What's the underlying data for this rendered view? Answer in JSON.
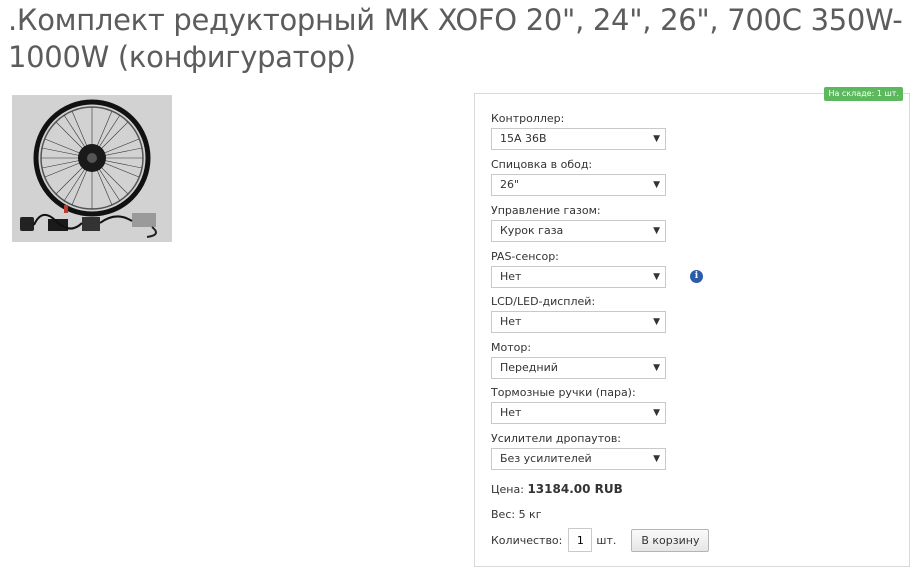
{
  "product": {
    "title": ".Комплект редукторный МК XOFO 20\", 24\", 26\", 700С 350W-1000W (конфигуратор)",
    "image_alt": "Комплект мотор-колеса"
  },
  "stock": {
    "badge": "На складе: 1 шт."
  },
  "options": [
    {
      "label": "Контроллер:",
      "value": "15А 36В"
    },
    {
      "label": "Спицовка в обод:",
      "value": "26\""
    },
    {
      "label": "Управление газом:",
      "value": "Курок газа"
    },
    {
      "label": "PAS-сенсор:",
      "value": "Нет"
    },
    {
      "label": "LCD/LED-дисплей:",
      "value": "Нет"
    },
    {
      "label": "Мотор:",
      "value": "Передний"
    },
    {
      "label": "Тормозные ручки (пара):",
      "value": "Нет"
    },
    {
      "label": "Усилители дропаутов:",
      "value": "Без усилителей"
    }
  ],
  "info_icon": {
    "icon": "info-icon",
    "glyph": "i",
    "color": "#2a5caa"
  },
  "price": {
    "label": "Цена:",
    "value": "13184.00 RUB"
  },
  "weight": {
    "text": "Вес: 5 кг"
  },
  "quantity": {
    "label": "Количество:",
    "value": "1",
    "unit": "шт."
  },
  "cart": {
    "button_label": "В корзину"
  },
  "colors": {
    "stock_badge": "#5cb85c",
    "title": "#5c5c5c"
  }
}
